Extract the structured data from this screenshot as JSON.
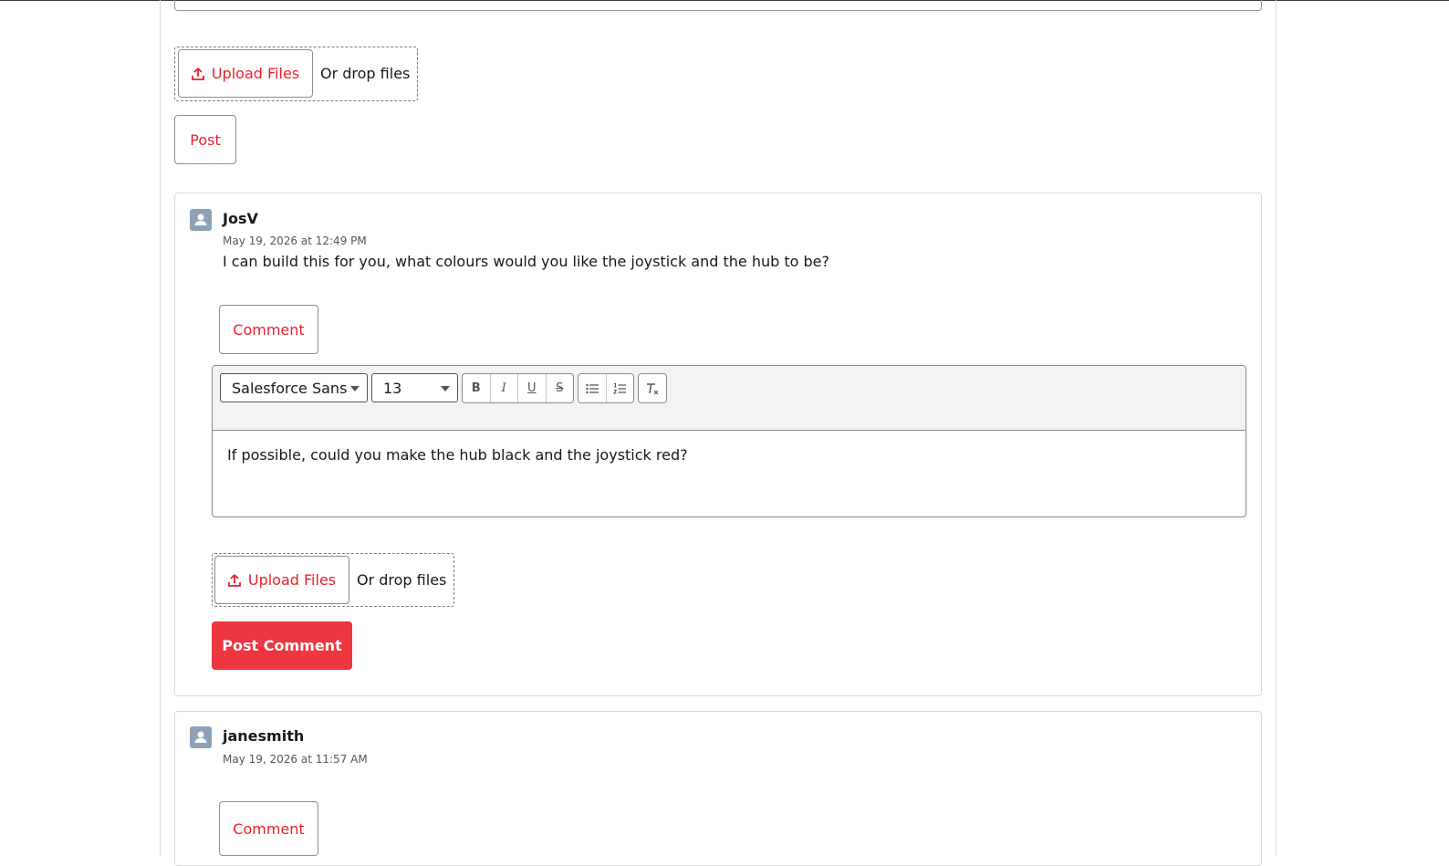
{
  "composer": {
    "upload_label": "Upload Files",
    "drop_label": "Or drop files",
    "post_label": "Post"
  },
  "posts": [
    {
      "author": "JosV",
      "timestamp": "May 19, 2026 at 12:49 PM",
      "body": "I can build this for you, what colours would you like the joystick and the hub to be?",
      "comment_label": "Comment",
      "editor": {
        "font_family": "Salesforce Sans",
        "font_size": "13",
        "toolbar_buttons": [
          "bold",
          "italic",
          "underline",
          "strikethrough",
          "bulleted-list",
          "numbered-list",
          "remove-formatting"
        ],
        "content": "If possible, could you make the hub black and the joystick red?"
      },
      "upload_label": "Upload Files",
      "drop_label": "Or drop files",
      "post_comment_label": "Post Comment"
    },
    {
      "author": "janesmith",
      "timestamp": "May 19, 2026 at 11:57 AM",
      "comment_label": "Comment"
    }
  ],
  "colors": {
    "brand_red": "#ee3640",
    "link_red": "#e8202b",
    "avatar": "#8ea2b6"
  }
}
